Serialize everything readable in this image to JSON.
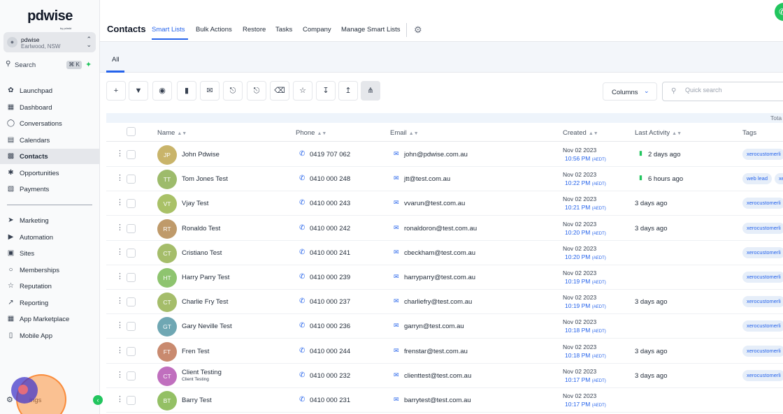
{
  "brand": {
    "logo_text": "pdwise",
    "logo_sub": "by pdmkt"
  },
  "account": {
    "name": "pdwise",
    "location": "Earlwood, NSW"
  },
  "sidebar_search": {
    "label": "Search",
    "shortcut": "⌘ K"
  },
  "nav_top": [
    {
      "label": "Launchpad",
      "icon": "rocket-icon"
    },
    {
      "label": "Dashboard",
      "icon": "dashboard-icon"
    },
    {
      "label": "Conversations",
      "icon": "chat-icon"
    },
    {
      "label": "Calendars",
      "icon": "calendar-icon"
    },
    {
      "label": "Contacts",
      "icon": "contacts-icon",
      "active": true
    },
    {
      "label": "Opportunities",
      "icon": "opportunities-icon"
    },
    {
      "label": "Payments",
      "icon": "payments-icon"
    }
  ],
  "nav_bottom": [
    {
      "label": "Marketing",
      "icon": "send-icon"
    },
    {
      "label": "Automation",
      "icon": "automation-icon"
    },
    {
      "label": "Sites",
      "icon": "sites-icon"
    },
    {
      "label": "Memberships",
      "icon": "membership-icon"
    },
    {
      "label": "Reputation",
      "icon": "star-icon"
    },
    {
      "label": "Reporting",
      "icon": "chart-icon"
    },
    {
      "label": "App Marketplace",
      "icon": "grid-icon"
    },
    {
      "label": "Mobile App",
      "icon": "mobile-icon"
    }
  ],
  "settings_label": "ings",
  "header": {
    "title": "Contacts",
    "tabs": [
      "Smart Lists",
      "Bulk Actions",
      "Restore",
      "Tasks",
      "Company",
      "Manage Smart Lists"
    ],
    "active_tab": "Smart Lists"
  },
  "subnav": {
    "tab": "All"
  },
  "toolbar": {
    "buttons": [
      "add-icon",
      "filter-icon",
      "robot-icon",
      "message-icon",
      "email-icon",
      "clipboard-add-icon",
      "clipboard-remove-icon",
      "trash-icon",
      "star-icon",
      "download-icon",
      "upload-icon",
      "merge-icon"
    ],
    "columns_label": "Columns",
    "search_placeholder": "Quick search"
  },
  "table": {
    "total_label": "Tota",
    "headers": {
      "name": "Name",
      "phone": "Phone",
      "email": "Email",
      "created": "Created",
      "last_activity": "Last Activity",
      "tags": "Tags"
    },
    "rows": [
      {
        "initials": "JP",
        "color": "#c9b46a",
        "name": "John Pdwise",
        "phone": "0419 707 062",
        "email": "john@pdwise.com.au",
        "created_date": "Nov 02 2023",
        "created_time": "10:56 PM",
        "tz": "(AEDT)",
        "last_activity": "2 days ago",
        "activity_icon": true,
        "tags": [
          "xerocustomerli"
        ]
      },
      {
        "initials": "TT",
        "color": "#9dbb6b",
        "name": "Tom Jones Test",
        "phone": "0410 000 248",
        "email": "jtt@test.com.au",
        "created_date": "Nov 02 2023",
        "created_time": "10:22 PM",
        "tz": "(AEDT)",
        "last_activity": "6 hours ago",
        "activity_icon": true,
        "tags": [
          "web lead",
          "xe"
        ]
      },
      {
        "initials": "VT",
        "color": "#a9c167",
        "name": "Vjay Test",
        "phone": "0410 000 243",
        "email": "vvarun@test.com.au",
        "created_date": "Nov 02 2023",
        "created_time": "10:21 PM",
        "tz": "(AEDT)",
        "last_activity": "3 days ago",
        "activity_icon": false,
        "tags": [
          "xerocustomerli"
        ]
      },
      {
        "initials": "RT",
        "color": "#bf9a6a",
        "name": "Ronaldo Test",
        "phone": "0410 000 242",
        "email": "ronaldoron@test.com.au",
        "created_date": "Nov 02 2023",
        "created_time": "10:20 PM",
        "tz": "(AEDT)",
        "last_activity": "3 days ago",
        "activity_icon": false,
        "tags": [
          "xerocustomerli"
        ]
      },
      {
        "initials": "CT",
        "color": "#a5bd6a",
        "name": "Cristiano Test",
        "phone": "0410 000 241",
        "email": "cbeckham@test.com.au",
        "created_date": "Nov 02 2023",
        "created_time": "10:20 PM",
        "tz": "(AEDT)",
        "last_activity": "",
        "activity_icon": false,
        "tags": [
          "xerocustomerli"
        ]
      },
      {
        "initials": "HT",
        "color": "#8ec46f",
        "name": "Harry Parry Test",
        "phone": "0410 000 239",
        "email": "harryparry@test.com.au",
        "created_date": "Nov 02 2023",
        "created_time": "10:19 PM",
        "tz": "(AEDT)",
        "last_activity": "",
        "activity_icon": false,
        "tags": [
          "xerocustomerli"
        ]
      },
      {
        "initials": "CT",
        "color": "#a5bd6a",
        "name": "Charlie Fry Test",
        "phone": "0410 000 237",
        "email": "charliefry@test.com.au",
        "created_date": "Nov 02 2023",
        "created_time": "10:19 PM",
        "tz": "(AEDT)",
        "last_activity": "3 days ago",
        "activity_icon": false,
        "tags": [
          "xerocustomerli"
        ]
      },
      {
        "initials": "GT",
        "color": "#6fa7b3",
        "name": "Gary Neville Test",
        "phone": "0410 000 236",
        "email": "garryn@test.com.au",
        "created_date": "Nov 02 2023",
        "created_time": "10:18 PM",
        "tz": "(AEDT)",
        "last_activity": "",
        "activity_icon": false,
        "tags": [
          "xerocustomerli"
        ]
      },
      {
        "initials": "FT",
        "color": "#c98a6f",
        "name": "Fren Test",
        "phone": "0410 000 244",
        "email": "frenstar@test.com.au",
        "created_date": "Nov 02 2023",
        "created_time": "10:18 PM",
        "tz": "(AEDT)",
        "last_activity": "3 days ago",
        "activity_icon": false,
        "tags": [
          "xerocustomerli"
        ]
      },
      {
        "initials": "CT",
        "color": "#c06fbe",
        "name": "Client Testing",
        "subname": "Client Testing",
        "phone": "0410 000 232",
        "email": "clienttest@test.com.au",
        "created_date": "Nov 02 2023",
        "created_time": "10:17 PM",
        "tz": "(AEDT)",
        "last_activity": "3 days ago",
        "activity_icon": false,
        "tags": [
          "xerocustomerli"
        ]
      },
      {
        "initials": "BT",
        "color": "#94c065",
        "name": "Barry Test",
        "phone": "0410 000 231",
        "email": "barrytest@test.com.au",
        "created_date": "Nov 02 2023",
        "created_time": "10:17 PM",
        "tz": "(AEDT)",
        "last_activity": "",
        "activity_icon": false,
        "tags": []
      }
    ]
  }
}
